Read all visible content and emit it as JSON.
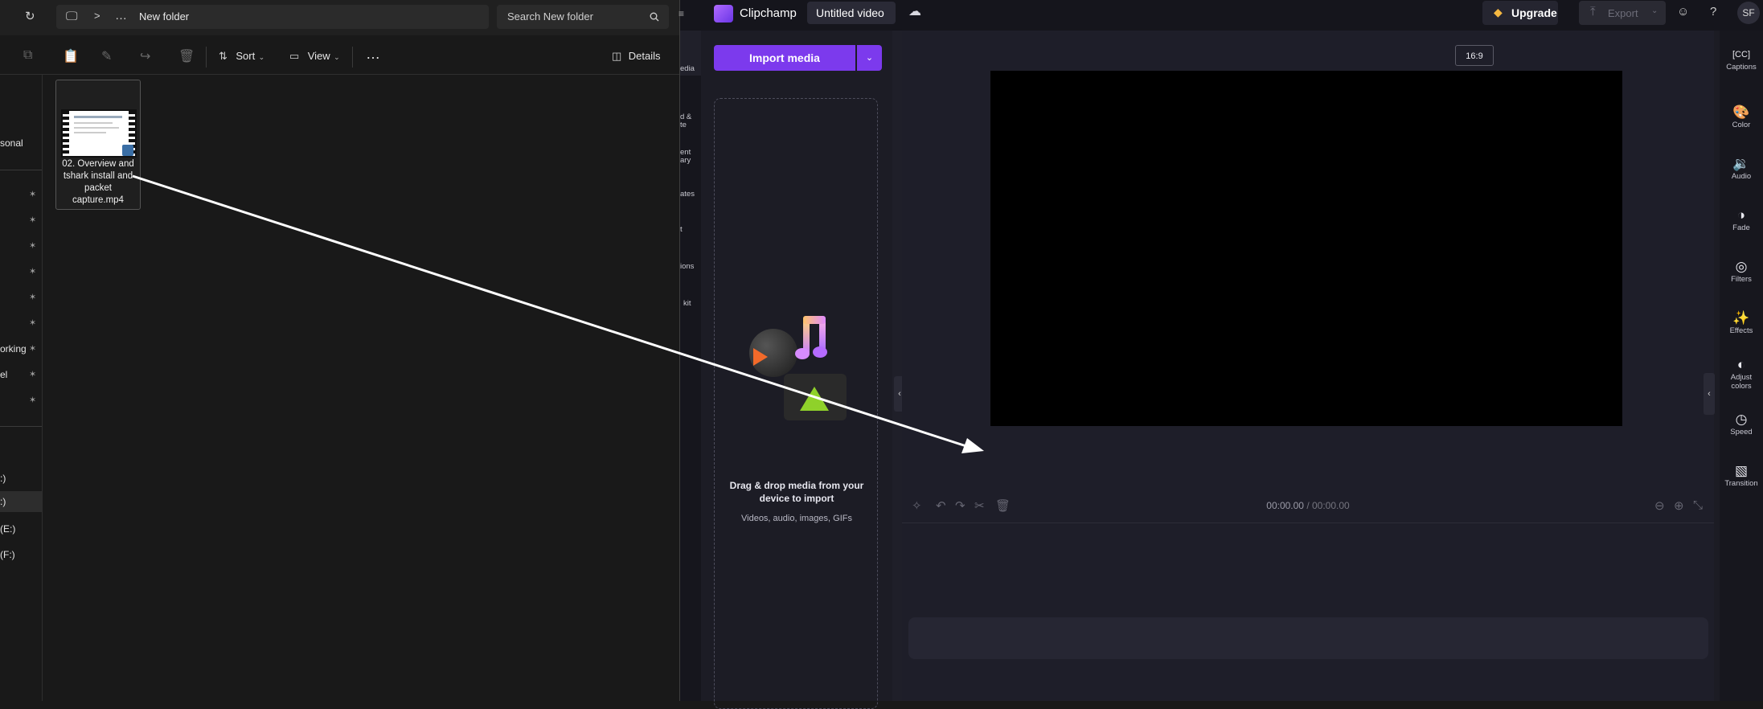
{
  "explorer": {
    "address": {
      "separator": ">",
      "more": "…",
      "path": "New folder"
    },
    "search": {
      "placeholder": "Search New folder"
    },
    "toolbar": {
      "sort_label": "Sort",
      "view_label": "View",
      "more_label": "…",
      "details_label": "Details"
    },
    "nav": {
      "items": [
        {
          "label": "sonal",
          "pinned": false
        },
        {
          "label": "",
          "pinned": true
        },
        {
          "label": "",
          "pinned": true
        },
        {
          "label": "",
          "pinned": true
        },
        {
          "label": "",
          "pinned": true
        },
        {
          "label": "",
          "pinned": true
        },
        {
          "label": "",
          "pinned": true
        },
        {
          "label": "orking",
          "pinned": true
        },
        {
          "label": "el",
          "pinned": true
        },
        {
          "label": "",
          "pinned": true
        }
      ],
      "drives": [
        ":)",
        ":)",
        "(E:)",
        "(F:)"
      ]
    },
    "file": {
      "name": "02. Overview and tshark install and packet capture.mp4"
    }
  },
  "clipchamp": {
    "brand": "Clipchamp",
    "project_title": "Untitled video",
    "upgrade_label": "Upgrade",
    "export_label": "Export",
    "avatar_initials": "SF",
    "left_rail": [
      "edia",
      "d &",
      "te",
      "ent",
      "ary",
      "ates",
      "t",
      "ions",
      "kit"
    ],
    "media_panel": {
      "import_label": "Import media",
      "drop_title": "Drag & drop media from your device to import",
      "drop_subtitle": "Videos, audio, images, GIFs"
    },
    "aspect_ratio": "16:9",
    "timecode_current": "00:00.00",
    "timecode_total": "/ 00:00.00",
    "right_rail": [
      {
        "label": "Captions",
        "icon": "captions-icon"
      },
      {
        "label": "Color",
        "icon": "palette-icon"
      },
      {
        "label": "Audio",
        "icon": "speaker-icon"
      },
      {
        "label": "Fade",
        "icon": "fade-icon"
      },
      {
        "label": "Filters",
        "icon": "filters-icon"
      },
      {
        "label": "Effects",
        "icon": "magic-wand-icon"
      },
      {
        "label": "Adjust colors",
        "icon": "contrast-icon"
      },
      {
        "label": "Speed",
        "icon": "speedometer-icon"
      },
      {
        "label": "Transition",
        "icon": "transition-icon"
      }
    ],
    "colors": {
      "accent": "#7c3aed",
      "upgrade_gem": "#f5b841"
    }
  }
}
